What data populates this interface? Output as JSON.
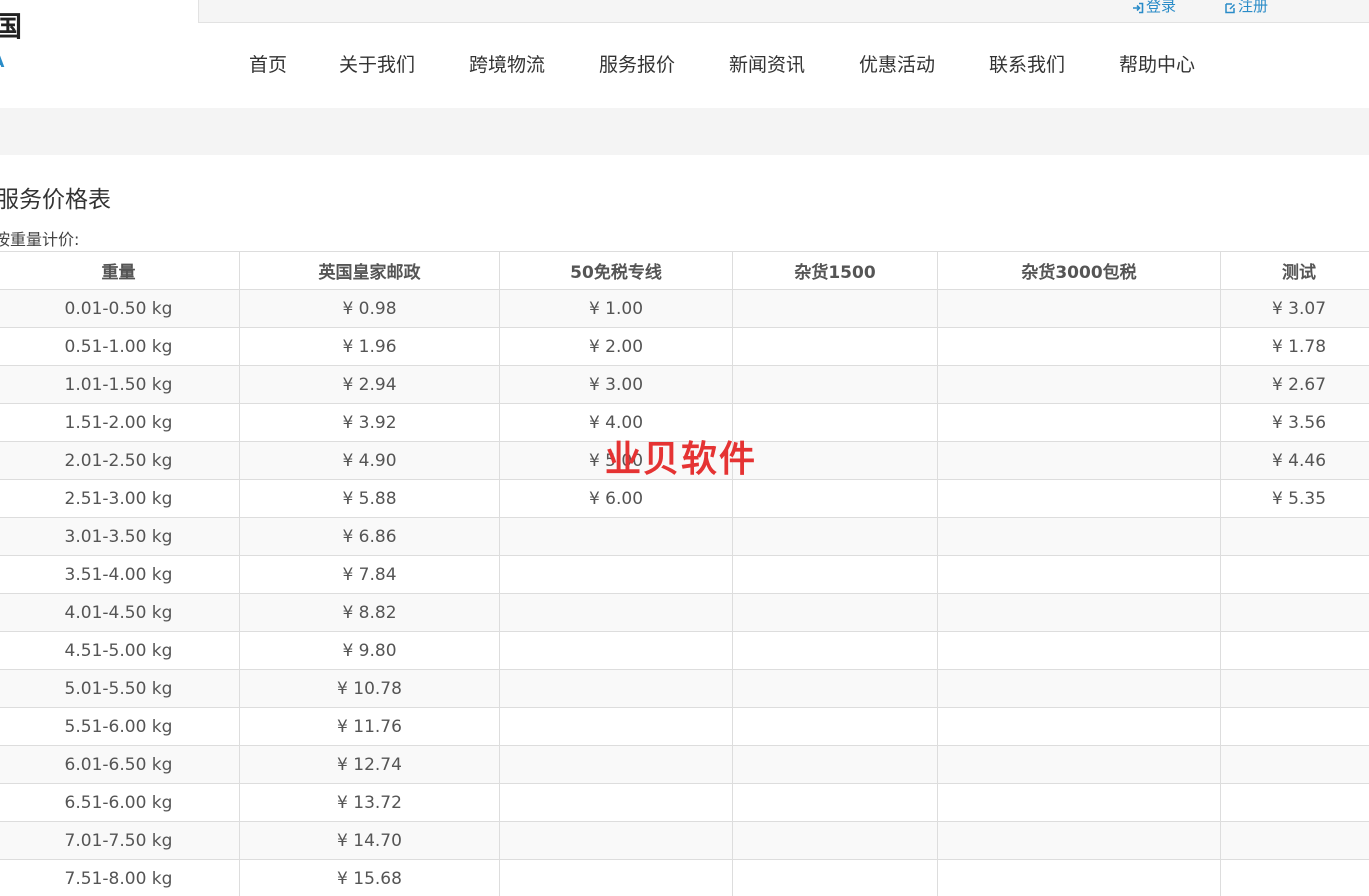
{
  "header": {
    "logo_char": "国",
    "logo_sub": "A",
    "login_label": "登录",
    "register_label": "注册"
  },
  "nav": {
    "items": [
      "首页",
      "关于我们",
      "跨境物流",
      "服务报价",
      "新闻资讯",
      "优惠活动",
      "联系我们",
      "帮助中心"
    ]
  },
  "main": {
    "title": "服务价格表",
    "subtitle": "按重量计价:",
    "columns": [
      "重量",
      "英国皇家邮政",
      "50免税专线",
      "杂货1500",
      "杂货3000包税",
      "测试"
    ],
    "rows": [
      [
        "0.01-0.50 kg",
        "¥ 0.98",
        "¥ 1.00",
        "",
        "",
        "¥ 3.07"
      ],
      [
        "0.51-1.00 kg",
        "¥ 1.96",
        "¥ 2.00",
        "",
        "",
        "¥ 1.78"
      ],
      [
        "1.01-1.50 kg",
        "¥ 2.94",
        "¥ 3.00",
        "",
        "",
        "¥ 2.67"
      ],
      [
        "1.51-2.00 kg",
        "¥ 3.92",
        "¥ 4.00",
        "",
        "",
        "¥ 3.56"
      ],
      [
        "2.01-2.50 kg",
        "¥ 4.90",
        "¥ 5.00",
        "",
        "",
        "¥ 4.46"
      ],
      [
        "2.51-3.00 kg",
        "¥ 5.88",
        "¥ 6.00",
        "",
        "",
        "¥ 5.35"
      ],
      [
        "3.01-3.50 kg",
        "¥ 6.86",
        "",
        "",
        "",
        ""
      ],
      [
        "3.51-4.00 kg",
        "¥ 7.84",
        "",
        "",
        "",
        ""
      ],
      [
        "4.01-4.50 kg",
        "¥ 8.82",
        "",
        "",
        "",
        ""
      ],
      [
        "4.51-5.00 kg",
        "¥ 9.80",
        "",
        "",
        "",
        ""
      ],
      [
        "5.01-5.50 kg",
        "¥ 10.78",
        "",
        "",
        "",
        ""
      ],
      [
        "5.51-6.00 kg",
        "¥ 11.76",
        "",
        "",
        "",
        ""
      ],
      [
        "6.01-6.50 kg",
        "¥ 12.74",
        "",
        "",
        "",
        ""
      ],
      [
        "6.51-6.00 kg",
        "¥ 13.72",
        "",
        "",
        "",
        ""
      ],
      [
        "7.01-7.50 kg",
        "¥ 14.70",
        "",
        "",
        "",
        ""
      ],
      [
        "7.51-8.00 kg",
        "¥ 15.68",
        "",
        "",
        "",
        ""
      ]
    ]
  },
  "watermark": "业贝软件",
  "colors": {
    "accent": "#2a8cc8",
    "watermark": "#e53333",
    "band": "#f4f4f4"
  }
}
